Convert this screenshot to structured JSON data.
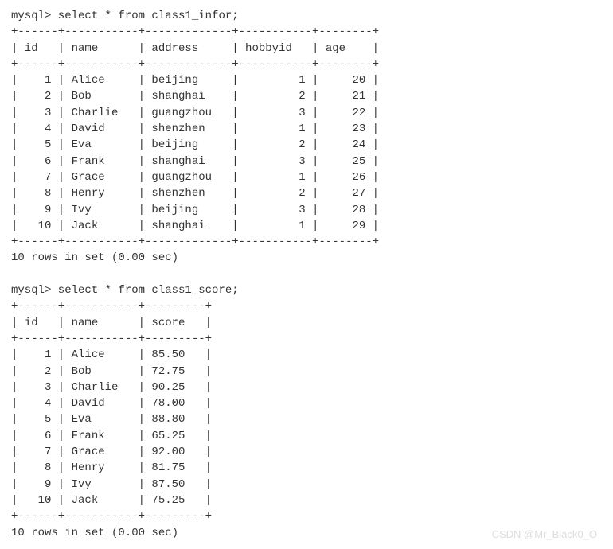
{
  "query1": {
    "prompt": "mysql>",
    "sql": "select * from class1_infor;",
    "columns": [
      "id",
      "name",
      "address",
      "hobbyid",
      "age"
    ],
    "widths": [
      4,
      9,
      11,
      9,
      6
    ],
    "align": [
      "r",
      "l",
      "l",
      "r",
      "r"
    ],
    "rows": [
      [
        1,
        "Alice",
        "beijing",
        1,
        20
      ],
      [
        2,
        "Bob",
        "shanghai",
        2,
        21
      ],
      [
        3,
        "Charlie",
        "guangzhou",
        3,
        22
      ],
      [
        4,
        "David",
        "shenzhen",
        1,
        23
      ],
      [
        5,
        "Eva",
        "beijing",
        2,
        24
      ],
      [
        6,
        "Frank",
        "shanghai",
        3,
        25
      ],
      [
        7,
        "Grace",
        "guangzhou",
        1,
        26
      ],
      [
        8,
        "Henry",
        "shenzhen",
        2,
        27
      ],
      [
        9,
        "Ivy",
        "beijing",
        3,
        28
      ],
      [
        10,
        "Jack",
        "shanghai",
        1,
        29
      ]
    ],
    "footer": "10 rows in set (0.00 sec)"
  },
  "query2": {
    "prompt": "mysql>",
    "sql": "select * from class1_score;",
    "columns": [
      "id",
      "name",
      "score"
    ],
    "widths": [
      4,
      9,
      7
    ],
    "align": [
      "r",
      "l",
      "l"
    ],
    "rows": [
      [
        1,
        "Alice",
        "85.50"
      ],
      [
        2,
        "Bob",
        "72.75"
      ],
      [
        3,
        "Charlie",
        "90.25"
      ],
      [
        4,
        "David",
        "78.00"
      ],
      [
        5,
        "Eva",
        "88.80"
      ],
      [
        6,
        "Frank",
        "65.25"
      ],
      [
        7,
        "Grace",
        "92.00"
      ],
      [
        8,
        "Henry",
        "81.75"
      ],
      [
        9,
        "Ivy",
        "87.50"
      ],
      [
        10,
        "Jack",
        "75.25"
      ]
    ],
    "footer": "10 rows in set (0.00 sec)"
  },
  "watermark": "CSDN @Mr_Black0_O"
}
